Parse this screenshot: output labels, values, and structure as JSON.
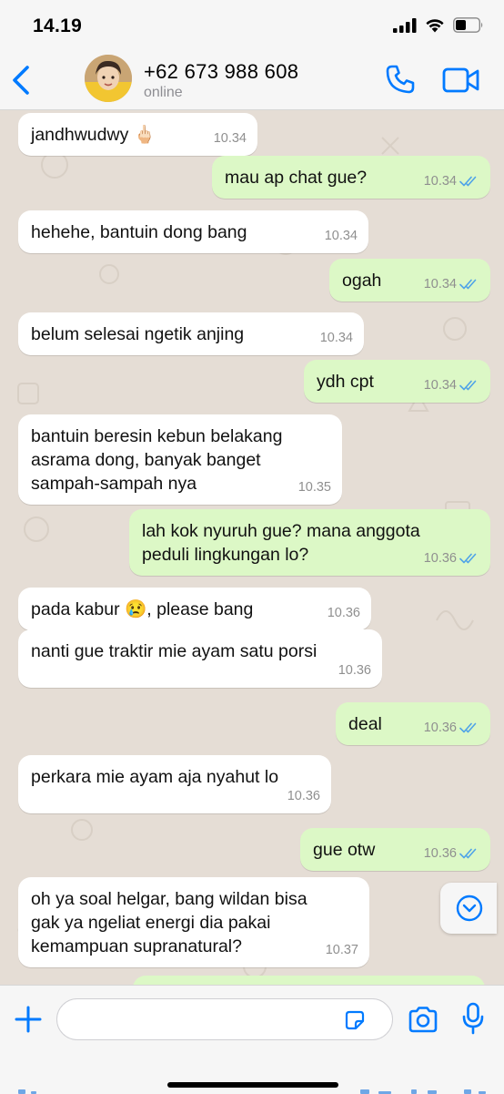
{
  "status_bar": {
    "time": "14.19"
  },
  "header": {
    "contact_name": "+62 673 988 608",
    "contact_status": "online",
    "icons": [
      "chevron-left-icon",
      "phone-icon",
      "video-camera-icon"
    ]
  },
  "messages": [
    {
      "dir": "in",
      "text": "jandhwudwy 🖕🏻",
      "time": "10.34"
    },
    {
      "dir": "out",
      "text": "mau ap chat gue?",
      "time": "10.34",
      "read": true
    },
    {
      "dir": "in",
      "text": "hehehe, bantuin dong bang",
      "time": "10.34"
    },
    {
      "dir": "out",
      "text": "ogah",
      "time": "10.34",
      "read": true
    },
    {
      "dir": "in",
      "text": "belum selesai ngetik anjing",
      "time": "10.34"
    },
    {
      "dir": "out",
      "text": "ydh cpt",
      "time": "10.34",
      "read": true
    },
    {
      "dir": "in",
      "text": "bantuin beresin kebun belakang\nasrama dong, banyak banget\nsampah-sampah nya",
      "time": "10.35"
    },
    {
      "dir": "out",
      "text": "lah kok nyuruh gue? mana anggota\npeduli lingkungan lo?",
      "time": "10.36",
      "read": true
    },
    {
      "dir": "in",
      "text": "pada kabur 😢, please bang",
      "time": "10.36"
    },
    {
      "dir": "in",
      "text": "nanti gue traktir mie ayam satu porsi",
      "time": "10.36"
    },
    {
      "dir": "out",
      "text": "deal",
      "time": "10.36",
      "read": true
    },
    {
      "dir": "in",
      "text": "perkara mie ayam aja nyahut lo",
      "time": "10.36"
    },
    {
      "dir": "out",
      "text": "gue otw",
      "time": "10.36",
      "read": true
    },
    {
      "dir": "in",
      "text": "oh ya soal helgar, bang wildan bisa\ngak ya ngeliat energi dia pakai\nkemampuan supranatural?",
      "time": "10.37"
    }
  ],
  "input_bar": {
    "placeholder": "",
    "icons": [
      "plus-icon",
      "sticker-icon",
      "camera-icon",
      "microphone-icon"
    ]
  },
  "colors": {
    "accent": "#007aff",
    "outgoing_bubble": "#dcf8c6",
    "incoming_bubble": "#ffffff",
    "chat_background": "#e5ddd5",
    "read_tick": "#4fa3e8"
  }
}
